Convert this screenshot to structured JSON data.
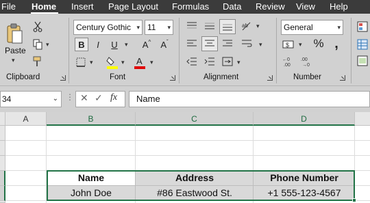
{
  "menu": {
    "tabs": [
      "File",
      "Home",
      "Insert",
      "Page Layout",
      "Formulas",
      "Data",
      "Review",
      "View",
      "Help"
    ],
    "active": "Home"
  },
  "ribbon": {
    "clipboard": {
      "label": "Clipboard",
      "paste_label": "Paste"
    },
    "font": {
      "label": "Font",
      "font_name": "Century Gothic",
      "font_size": "11",
      "bold": "B",
      "italic": "I",
      "underline": "U",
      "grow": "A",
      "shrink": "A",
      "highlight_color": "#ffff00",
      "font_color": "#e00000"
    },
    "alignment": {
      "label": "Alignment"
    },
    "number": {
      "label": "Number",
      "format": "General",
      "currency_symbol": "$",
      "percent_symbol": "%"
    }
  },
  "formula_bar": {
    "name_box": "34",
    "fx": "fx",
    "value": "Name"
  },
  "sheet": {
    "columns": [
      "A",
      "B",
      "C",
      "D"
    ],
    "headers": [
      "Name",
      "Address",
      "Phone Number"
    ],
    "rows": [
      [
        "John Doe",
        "#86 Eastwood St.",
        "+1 555-123-4567"
      ]
    ]
  },
  "colors": {
    "accent": "#217346",
    "menubar": "#3b3b3b",
    "ribbon": "#d1d1d1"
  }
}
